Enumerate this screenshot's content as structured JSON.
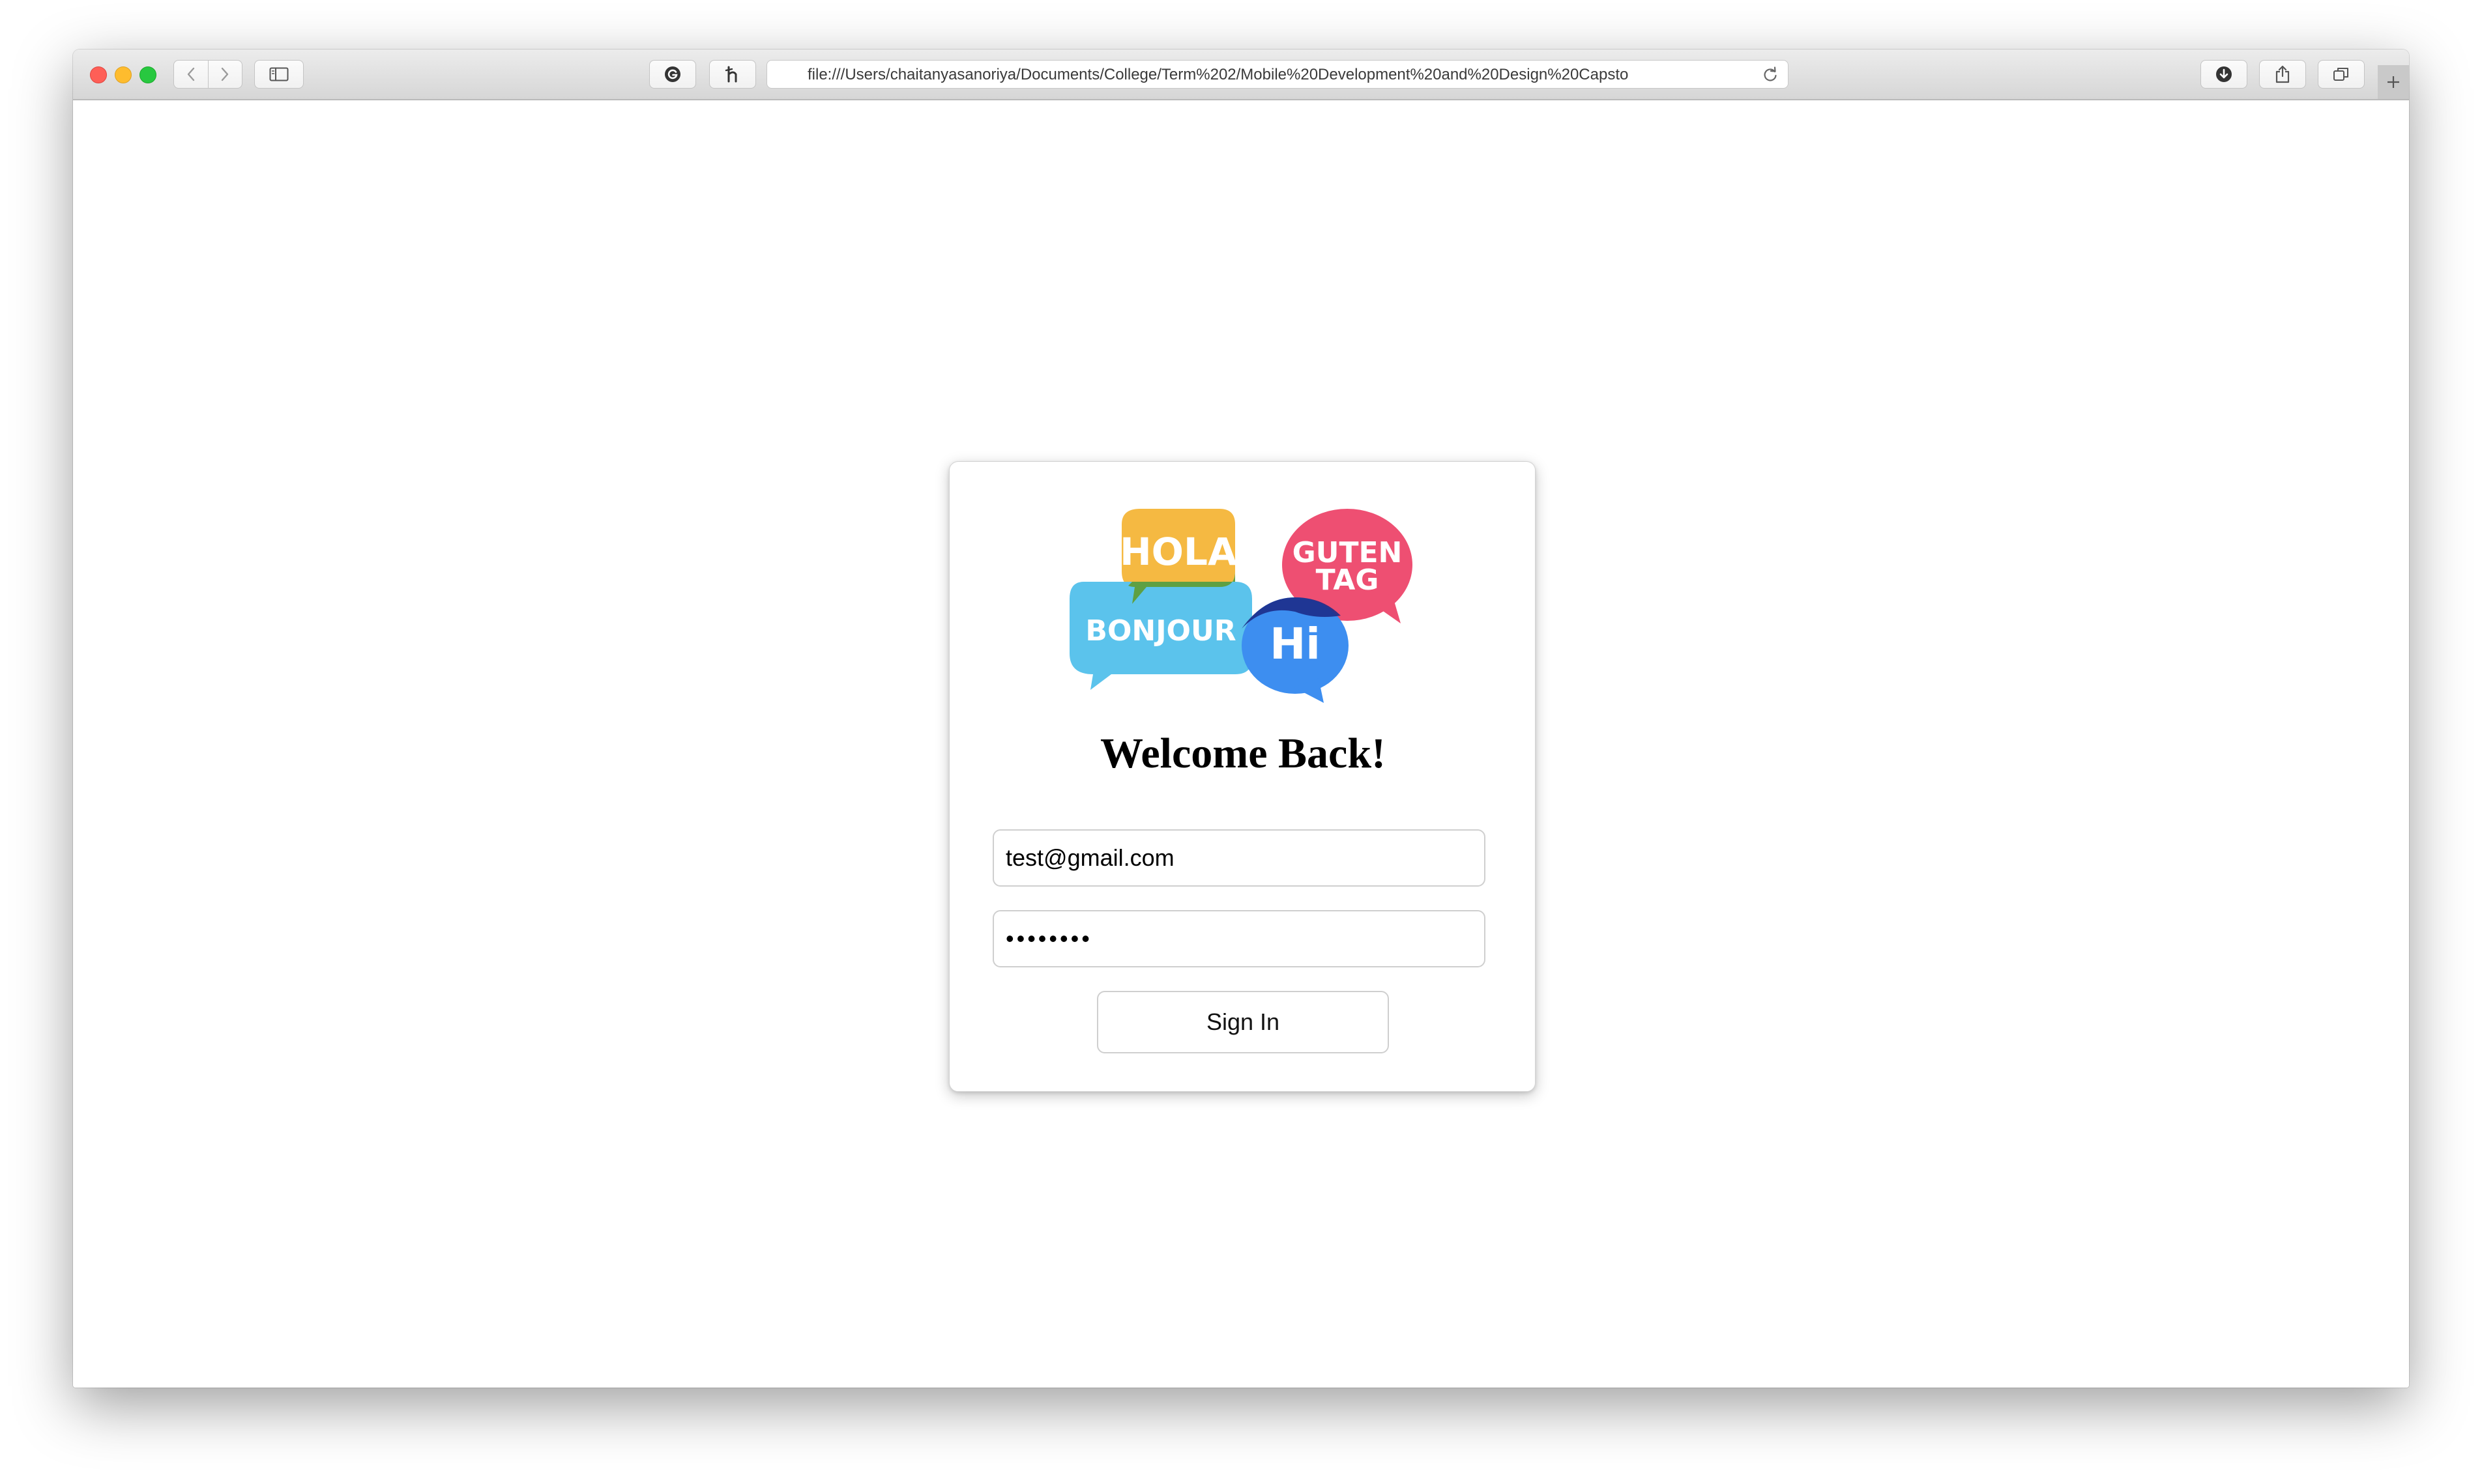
{
  "browser": {
    "address_url": "file:///Users/chaitanyasanoriya/Documents/College/Term%202/Mobile%20Development%20and%20Design%20Capsto",
    "icons": {
      "back": "chevron-left-icon",
      "forward": "chevron-right-icon",
      "sidebar": "sidebar-icon",
      "extension_g": "grammarly-icon",
      "extension_h": "honey-icon",
      "reload": "reload-icon",
      "downloads": "download-icon",
      "share": "share-icon",
      "tabs": "tab-overview-icon",
      "new_tab": "plus-icon"
    }
  },
  "login": {
    "logo_words": {
      "hola": "HOLA",
      "guten": "GUTEN",
      "tag": "TAG",
      "bonjour": "BONJOUR",
      "hi": "Hi"
    },
    "title": "Welcome Back!",
    "email_value": "test@gmail.com",
    "password_value": "••••••••",
    "sign_in_label": "Sign In"
  },
  "colors": {
    "bubble_yellow": "#f5b942",
    "bubble_pink": "#ee4f72",
    "bubble_cyan": "#5bc3ec",
    "bubble_blue": "#3d8ef0",
    "overlap_green": "#5f9e3a",
    "overlap_navy": "#1c2c8a",
    "close": "#fe5f57",
    "minimize": "#febc2e",
    "maximize": "#28c840"
  }
}
